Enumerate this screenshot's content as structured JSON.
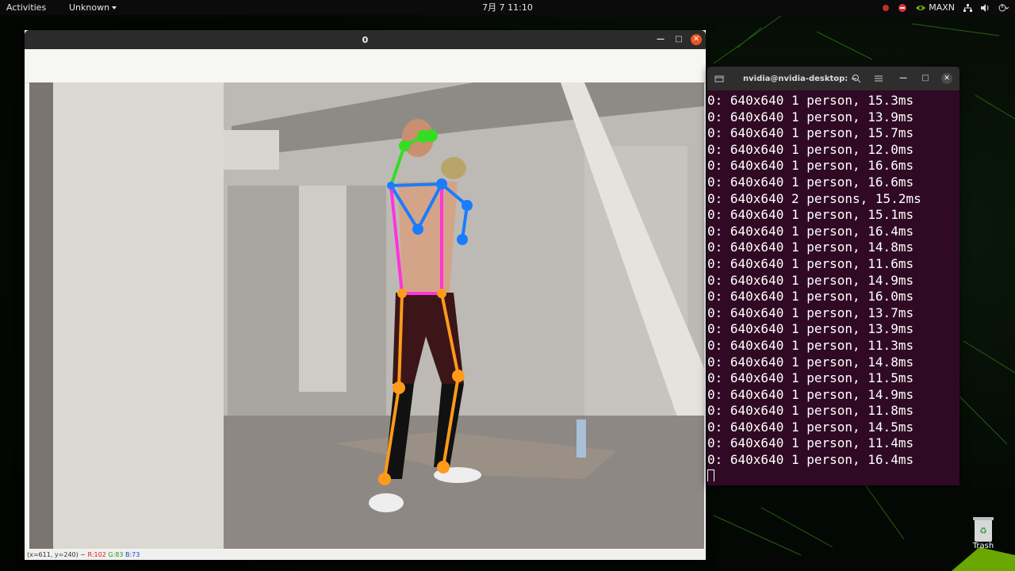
{
  "topbar": {
    "activities": "Activities",
    "app_menu": "Unknown",
    "clock": "7月 7  11:10",
    "tray": {
      "nvidia_mode": "MAXN",
      "icons": [
        "indicator-red-icon",
        "stop-icon",
        "nvidia-icon",
        "network-icon",
        "volume-icon",
        "power-icon"
      ]
    }
  },
  "viewer": {
    "title": "0",
    "status": {
      "coords": "(x=611, y=240) ~",
      "r": "R:102",
      "g": "G:83",
      "b": "B:73"
    }
  },
  "terminal": {
    "title": "nvidia@nvidia-desktop: ~",
    "lines": [
      "0: 640x640 1 person, 15.3ms",
      "0: 640x640 1 person, 13.9ms",
      "0: 640x640 1 person, 15.7ms",
      "0: 640x640 1 person, 12.0ms",
      "0: 640x640 1 person, 16.6ms",
      "0: 640x640 1 person, 16.6ms",
      "0: 640x640 2 persons, 15.2ms",
      "0: 640x640 1 person, 15.1ms",
      "0: 640x640 1 person, 16.4ms",
      "0: 640x640 1 person, 14.8ms",
      "0: 640x640 1 person, 11.6ms",
      "0: 640x640 1 person, 14.9ms",
      "0: 640x640 1 person, 16.0ms",
      "0: 640x640 1 person, 13.7ms",
      "0: 640x640 1 person, 13.9ms",
      "0: 640x640 1 person, 11.3ms",
      "0: 640x640 1 person, 14.8ms",
      "0: 640x640 1 person, 11.5ms",
      "0: 640x640 1 person, 14.9ms",
      "0: 640x640 1 person, 11.8ms",
      "0: 640x640 1 person, 14.5ms",
      "0: 640x640 1 person, 11.4ms",
      "0: 640x640 1 person, 16.4ms"
    ]
  },
  "desktop": {
    "trash_label": "Trash"
  },
  "colors": {
    "terminal_bg": "#300a24",
    "topbar_bg": "#0b0b0b",
    "close_button": "#e9541f",
    "skeleton_head": "#33dd22",
    "skeleton_arm": "#1a7cff",
    "skeleton_torso": "#ff33dd",
    "skeleton_leg": "#ff9a1a"
  }
}
